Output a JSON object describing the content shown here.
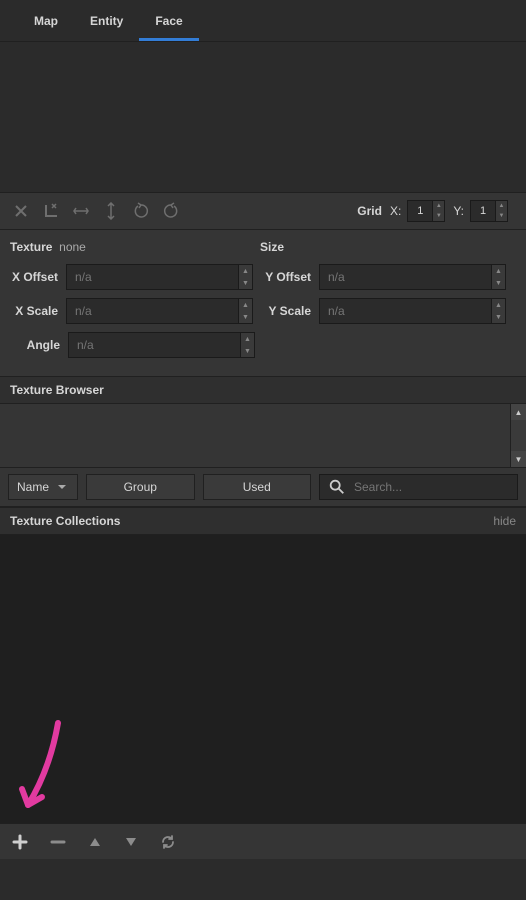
{
  "tabs": {
    "map": "Map",
    "entity": "Entity",
    "face": "Face"
  },
  "toolbar": {
    "grid_label": "Grid",
    "x_label": "X:",
    "x_value": "1",
    "y_label": "Y:",
    "y_value": "1"
  },
  "props": {
    "header_texture": "Texture",
    "header_texture_sub": "none",
    "header_size": "Size",
    "xoffset_label": "X Offset",
    "xoffset_value": "n/a",
    "yoffset_label": "Y Offset",
    "yoffset_value": "n/a",
    "xscale_label": "X Scale",
    "xscale_value": "n/a",
    "yscale_label": "Y Scale",
    "yscale_value": "n/a",
    "angle_label": "Angle",
    "angle_value": "n/a"
  },
  "texture_browser": {
    "title": "Texture Browser",
    "name_dropdown": "Name",
    "group_button": "Group",
    "used_button": "Used",
    "search_placeholder": "Search..."
  },
  "texture_collections": {
    "title": "Texture Collections",
    "hide_link": "hide"
  }
}
